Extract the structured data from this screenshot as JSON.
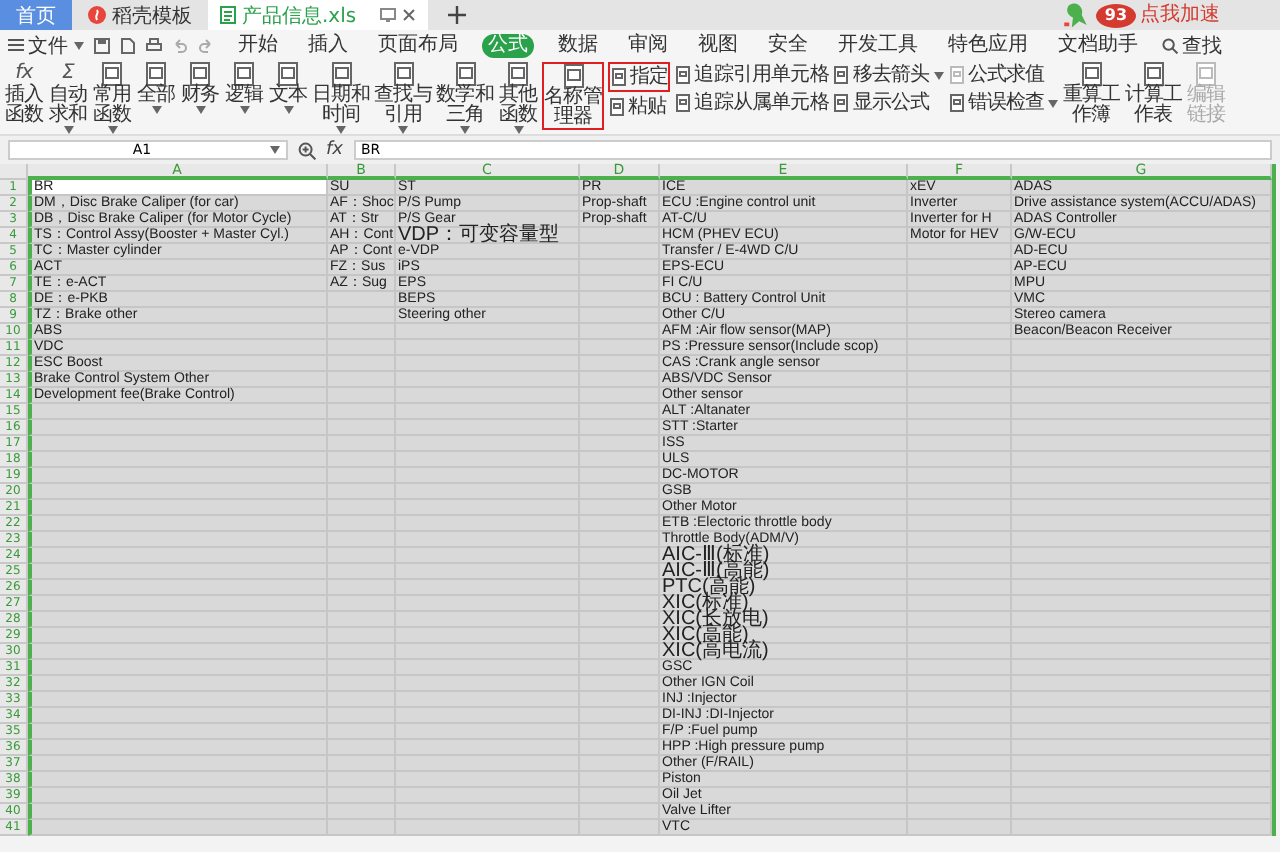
{
  "tabs": [
    {
      "label": "首页",
      "kind": "home",
      "selected": false
    },
    {
      "label": "稻壳模板",
      "kind": "template",
      "selected": false
    },
    {
      "label": "产品信息.xls",
      "kind": "file",
      "selected": true
    }
  ],
  "speed_badge": {
    "score": "93",
    "label": "点我加速"
  },
  "menu": {
    "file": "文件",
    "items": [
      {
        "label": "开始",
        "selected": false
      },
      {
        "label": "插入",
        "selected": false
      },
      {
        "label": "页面布局",
        "selected": false
      },
      {
        "label": "公式",
        "selected": true
      },
      {
        "label": "数据",
        "selected": false
      },
      {
        "label": "审阅",
        "selected": false
      },
      {
        "label": "视图",
        "selected": false
      },
      {
        "label": "安全",
        "selected": false
      },
      {
        "label": "开发工具",
        "selected": false
      },
      {
        "label": "特色应用",
        "selected": false
      },
      {
        "label": "文档助手",
        "selected": false
      }
    ],
    "search": "查找"
  },
  "ribbon": [
    {
      "kind": "large",
      "label": "插入函数",
      "glyph": "fx",
      "dropdown": false,
      "highlighted": false,
      "disabled": false
    },
    {
      "kind": "large",
      "label": "自动求和",
      "glyph": "Σ",
      "dropdown": true,
      "highlighted": false,
      "disabled": false
    },
    {
      "kind": "large",
      "label": "常用函数",
      "dropdown": true,
      "highlighted": false,
      "disabled": false
    },
    {
      "kind": "large",
      "label": "全部",
      "dropdown": true,
      "highlighted": false,
      "disabled": false
    },
    {
      "kind": "large",
      "label": "财务",
      "dropdown": true,
      "highlighted": false,
      "disabled": false
    },
    {
      "kind": "large",
      "label": "逻辑",
      "dropdown": true,
      "highlighted": false,
      "disabled": false
    },
    {
      "kind": "large",
      "label": "文本",
      "dropdown": true,
      "highlighted": false,
      "disabled": false
    },
    {
      "kind": "large",
      "label": "日期和时间",
      "dropdown": true,
      "highlighted": false,
      "disabled": false
    },
    {
      "kind": "large",
      "label": "查找与引用",
      "dropdown": true,
      "highlighted": false,
      "disabled": false
    },
    {
      "kind": "large",
      "label": "数学和三角",
      "dropdown": true,
      "highlighted": false,
      "disabled": false
    },
    {
      "kind": "large",
      "label": "其他函数",
      "dropdown": true,
      "highlighted": false,
      "disabled": false
    },
    {
      "kind": "large",
      "label": "名称管理器",
      "dropdown": false,
      "highlighted": true,
      "disabled": false
    },
    {
      "kind": "stack",
      "items": [
        {
          "label": "指定",
          "dropdown": false,
          "highlighted": true,
          "disabled": false
        },
        {
          "label": "粘贴",
          "dropdown": false,
          "highlighted": false,
          "disabled": false
        }
      ]
    },
    {
      "kind": "stack",
      "items": [
        {
          "label": "追踪引用单元格",
          "dropdown": false,
          "highlighted": false,
          "disabled": false
        },
        {
          "label": "追踪从属单元格",
          "dropdown": false,
          "highlighted": false,
          "disabled": false
        }
      ]
    },
    {
      "kind": "stack",
      "items": [
        {
          "label": "移去箭头",
          "dropdown": true,
          "highlighted": false,
          "disabled": false
        },
        {
          "label": "显示公式",
          "dropdown": false,
          "highlighted": false,
          "disabled": false
        }
      ]
    },
    {
      "kind": "stack",
      "items": [
        {
          "label": "公式求值",
          "dropdown": false,
          "highlighted": false,
          "disabled": true
        },
        {
          "label": "错误检查",
          "dropdown": true,
          "highlighted": false,
          "disabled": false
        }
      ]
    },
    {
      "kind": "large",
      "label": "重算工作簿",
      "dropdown": false,
      "highlighted": false,
      "disabled": false
    },
    {
      "kind": "large",
      "label": "计算工作表",
      "dropdown": false,
      "highlighted": false,
      "disabled": false
    },
    {
      "kind": "large",
      "label": "编辑链接",
      "dropdown": false,
      "highlighted": false,
      "disabled": true
    }
  ],
  "formula_bar": {
    "name_box": "A1",
    "fx": "fx",
    "value": "BR"
  },
  "sheet": {
    "columns": [
      "A",
      "B",
      "C",
      "D",
      "E",
      "F",
      "G"
    ],
    "rows": [
      {
        "number": "1",
        "cells": {
          "A": "BR",
          "B": "SU",
          "C": "ST",
          "D": "PR",
          "E": "ICE",
          "F": "xEV",
          "G": "ADAS"
        }
      },
      {
        "number": "2",
        "cells": {
          "A": "DM，Disc Brake Caliper (for car)",
          "B": "AF：Shoc",
          "C": "P/S Pump",
          "D": "Prop-shaft",
          "E": "ECU :Engine control unit",
          "F": "Inverter",
          "G": "Drive assistance system(ACCU/ADAS)"
        }
      },
      {
        "number": "3",
        "cells": {
          "A": "DB，Disc Brake Caliper (for Motor Cycle)",
          "B": "AT：Str",
          "C": "P/S Gear",
          "D": "Prop-shaft",
          "E": "AT-C/U",
          "F": "Inverter for H",
          "G": "ADAS Controller"
        }
      },
      {
        "number": "4",
        "cells": {
          "A": "TS：Control Assy(Booster + Master Cyl.)",
          "B": "AH：Cont",
          "C": "VDP：可变容量型",
          "E": "HCM (PHEV ECU)",
          "F": "Motor for HEV",
          "G": "G/W-ECU"
        }
      },
      {
        "number": "5",
        "cells": {
          "A": "TC：Master cylinder",
          "B": "AP：Cont",
          "C": "e-VDP",
          "E": "Transfer / E-4WD  C/U",
          "G": "AD-ECU"
        }
      },
      {
        "number": "6",
        "cells": {
          "A": "ACT",
          "B": "FZ：Sus",
          "C": "iPS",
          "E": "EPS-ECU",
          "G": "AP-ECU"
        }
      },
      {
        "number": "7",
        "cells": {
          "A": "TE：e-ACT",
          "B": "AZ：Sug",
          "C": "EPS",
          "E": "FI C/U",
          "G": "MPU"
        }
      },
      {
        "number": "8",
        "cells": {
          "A": "DE：e-PKB",
          "C": "BEPS",
          "E": "BCU : Battery Control Unit",
          "G": "VMC"
        }
      },
      {
        "number": "9",
        "cells": {
          "A": "TZ：Brake other",
          "C": "Steering other",
          "E": "Other C/U",
          "G": "Stereo camera"
        }
      },
      {
        "number": "10",
        "cells": {
          "A": "ABS",
          "E": "AFM :Air flow sensor(MAP)",
          "G": "Beacon/Beacon Receiver"
        }
      },
      {
        "number": "11",
        "cells": {
          "A": "VDC",
          "E": "PS :Pressure sensor(Include scop)"
        }
      },
      {
        "number": "12",
        "cells": {
          "A": "ESC Boost",
          "E": "CAS :Crank angle sensor"
        }
      },
      {
        "number": "13",
        "cells": {
          "A": "Brake Control System Other",
          "E": "ABS/VDC Sensor"
        }
      },
      {
        "number": "14",
        "cells": {
          "A": "Development fee(Brake Control)",
          "E": "Other sensor"
        }
      },
      {
        "number": "15",
        "cells": {
          "E": "ALT :Altanater"
        }
      },
      {
        "number": "16",
        "cells": {
          "E": "STT :Starter"
        }
      },
      {
        "number": "17",
        "cells": {
          "E": "ISS"
        }
      },
      {
        "number": "18",
        "cells": {
          "E": "ULS"
        }
      },
      {
        "number": "19",
        "cells": {
          "E": "DC-MOTOR"
        }
      },
      {
        "number": "20",
        "cells": {
          "E": "GSB"
        }
      },
      {
        "number": "21",
        "cells": {
          "E": "Other Motor"
        }
      },
      {
        "number": "22",
        "cells": {
          "E": "ETB :Electoric throttle body"
        }
      },
      {
        "number": "23",
        "cells": {
          "E": "Throttle Body(ADM/V)"
        }
      },
      {
        "number": "24",
        "cells": {
          "E": "AIC-Ⅲ(标准)"
        }
      },
      {
        "number": "25",
        "cells": {
          "E": "AIC-Ⅲ(高能)"
        }
      },
      {
        "number": "26",
        "cells": {
          "E": "PTC(高能)"
        }
      },
      {
        "number": "27",
        "cells": {
          "E": "XIC(标准)"
        }
      },
      {
        "number": "28",
        "cells": {
          "E": "XIC(长放电)"
        }
      },
      {
        "number": "29",
        "cells": {
          "E": "XIC(高能)"
        }
      },
      {
        "number": "30",
        "cells": {
          "E": "XIC(高电流)"
        }
      },
      {
        "number": "31",
        "cells": {
          "E": "GSC"
        }
      },
      {
        "number": "32",
        "cells": {
          "E": "Other IGN Coil"
        }
      },
      {
        "number": "33",
        "cells": {
          "E": "INJ :Injector"
        }
      },
      {
        "number": "34",
        "cells": {
          "E": "DI-INJ :DI-Injector"
        }
      },
      {
        "number": "35",
        "cells": {
          "E": "F/P :Fuel pump"
        }
      },
      {
        "number": "36",
        "cells": {
          "E": "HPP :High pressure pump"
        }
      },
      {
        "number": "37",
        "cells": {
          "E": "Other (F/RAIL)"
        }
      },
      {
        "number": "38",
        "cells": {
          "E": "Piston"
        }
      },
      {
        "number": "39",
        "cells": {
          "E": "Oil Jet"
        }
      },
      {
        "number": "40",
        "cells": {
          "E": "Valve Lifter"
        }
      },
      {
        "number": "41",
        "cells": {
          "E": "VTC"
        }
      }
    ]
  }
}
